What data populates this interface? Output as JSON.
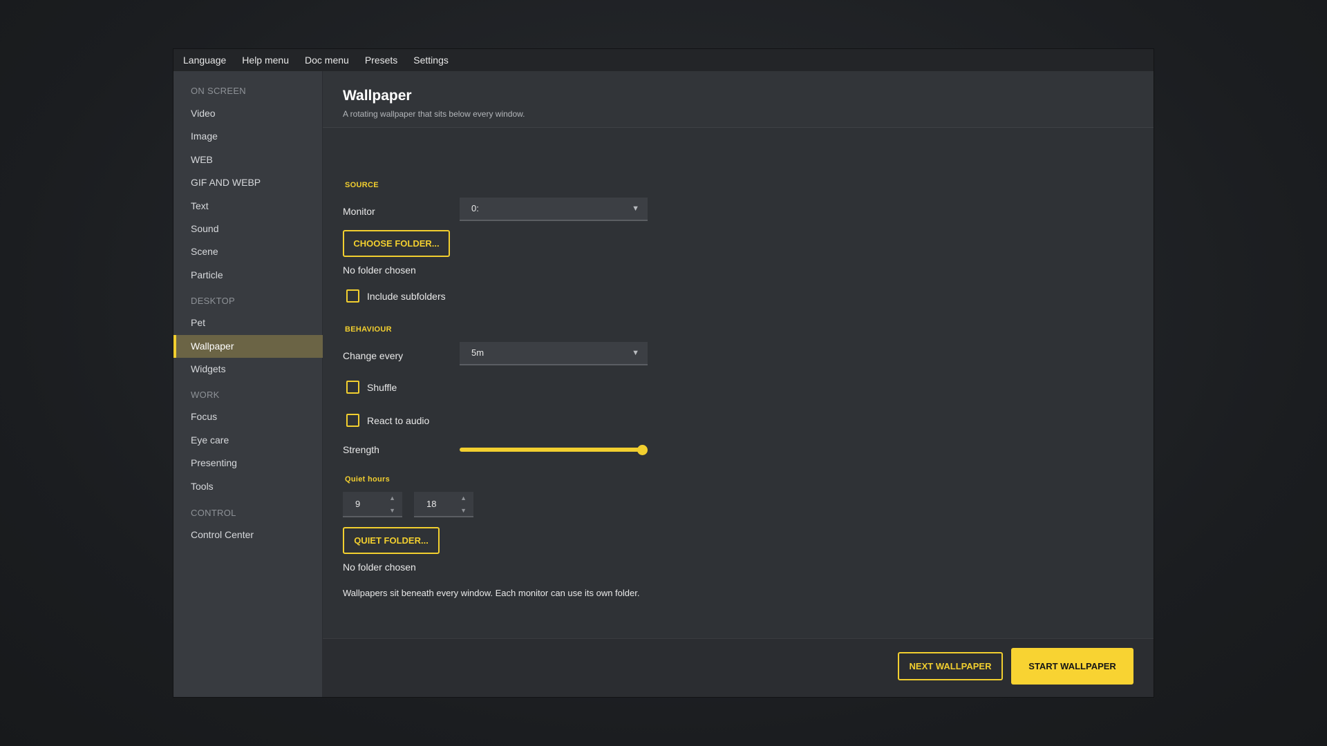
{
  "menubar": [
    "Language",
    "Help menu",
    "Doc menu",
    "Presets",
    "Settings"
  ],
  "sidebar": {
    "sections": {
      "on_screen": "ON SCREEN",
      "desktop": "DESKTOP",
      "work": "WORK",
      "control": "CONTROL"
    },
    "items": {
      "video": "Video",
      "image": "Image",
      "web": "WEB",
      "gif": "GIF AND WEBP",
      "text": "Text",
      "sound": "Sound",
      "scene": "Scene",
      "particle": "Particle",
      "pet": "Pet",
      "wallpaper": "Wallpaper",
      "widgets": "Widgets",
      "focus": "Focus",
      "eye_care": "Eye care",
      "presenting": "Presenting",
      "tools": "Tools",
      "control_center": "Control Center"
    },
    "active": "Wallpaper"
  },
  "header": {
    "title": "Wallpaper",
    "subtitle": "A rotating wallpaper that sits below every window."
  },
  "source": {
    "heading": "SOURCE",
    "monitor_label": "Monitor",
    "monitor_value": "0:",
    "choose_folder": "CHOOSE FOLDER...",
    "folder_status": "No folder chosen",
    "include_subfolders": "Include subfolders",
    "include_subfolders_checked": false
  },
  "behaviour": {
    "heading": "BEHAVIOUR",
    "change_every_label": "Change every",
    "change_every_value": "5m",
    "shuffle": "Shuffle",
    "shuffle_checked": false,
    "react_audio": "React to audio",
    "react_audio_checked": false,
    "strength_label": "Strength",
    "strength_value": 1.0
  },
  "quiet": {
    "heading": "Quiet hours",
    "start": "9",
    "end": "18",
    "quiet_folder": "QUIET FOLDER...",
    "folder_status": "No folder chosen"
  },
  "info": "Wallpapers sit beneath every window. Each monitor can use its own folder.",
  "footer": {
    "next": "NEXT WALLPAPER",
    "start": "START WALLPAPER"
  },
  "colors": {
    "accent": "#f2cf2f",
    "active_nav": "#6b6445"
  },
  "icons": {
    "select_caret": "▼",
    "spin_up": "▲",
    "spin_down": "▼"
  }
}
